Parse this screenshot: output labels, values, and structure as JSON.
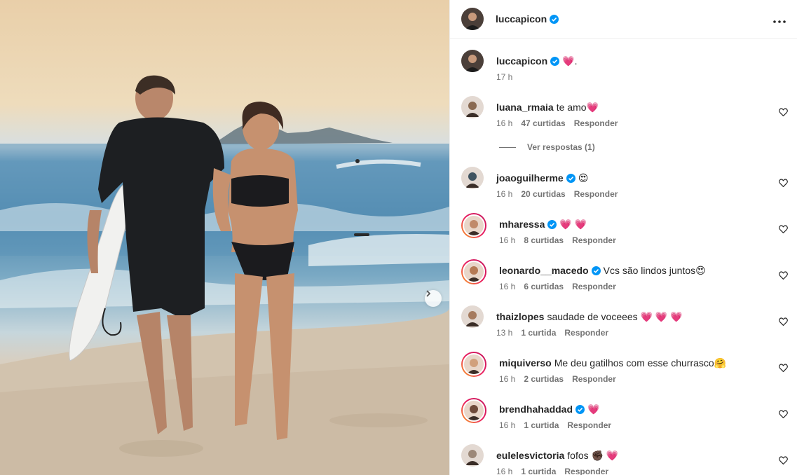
{
  "post": {
    "author": "luccapicon",
    "more_icon": "more-options-icon",
    "caption_text": "💗.",
    "caption_time": "17 h"
  },
  "labels": {
    "reply": "Responder",
    "view_replies": "Ver respostas (1)"
  },
  "comments": [
    {
      "user": "luana_rmaia",
      "text": "te amo💗",
      "time": "16 h",
      "likes": "47 curtidas",
      "verified": false,
      "ring": false,
      "avatar_color": "#8a6a52"
    },
    {
      "user": "joaoguilherme",
      "text": "😍",
      "time": "16 h",
      "likes": "20 curtidas",
      "verified": true,
      "ring": false,
      "avatar_color": "#3f5360"
    },
    {
      "user": "mharessa",
      "text": "💗 💗",
      "time": "16 h",
      "likes": "8 curtidas",
      "verified": true,
      "ring": true,
      "avatar_color": "#c08a6a"
    },
    {
      "user": "leonardo__macedo",
      "text": "Vcs são lindos juntos😍",
      "time": "16 h",
      "likes": "6 curtidas",
      "verified": true,
      "ring": true,
      "avatar_color": "#b57a55"
    },
    {
      "user": "thaizlopes",
      "text": "saudade de voceees 💗 💗 💗",
      "time": "13 h",
      "likes": "1 curtida",
      "verified": false,
      "ring": false,
      "avatar_color": "#a67b5e"
    },
    {
      "user": "miquiverso",
      "text": "Me deu gatilhos com esse churrasco🤗",
      "time": "16 h",
      "likes": "2 curtidas",
      "verified": false,
      "ring": true,
      "avatar_color": "#d1a07c"
    },
    {
      "user": "brendhahaddad",
      "text": "💗",
      "time": "16 h",
      "likes": "1 curtida",
      "verified": true,
      "ring": true,
      "avatar_color": "#6e4a3a"
    },
    {
      "user": "eulelesvictoria",
      "text": "fofos ✊🏿 💗",
      "time": "16 h",
      "likes": "1 curtida",
      "verified": false,
      "ring": false,
      "avatar_color": "#9c8878"
    }
  ],
  "colors": {
    "verified_blue": "#0095f6",
    "meta_gray": "#737373",
    "heart_red": "#ed4956"
  }
}
